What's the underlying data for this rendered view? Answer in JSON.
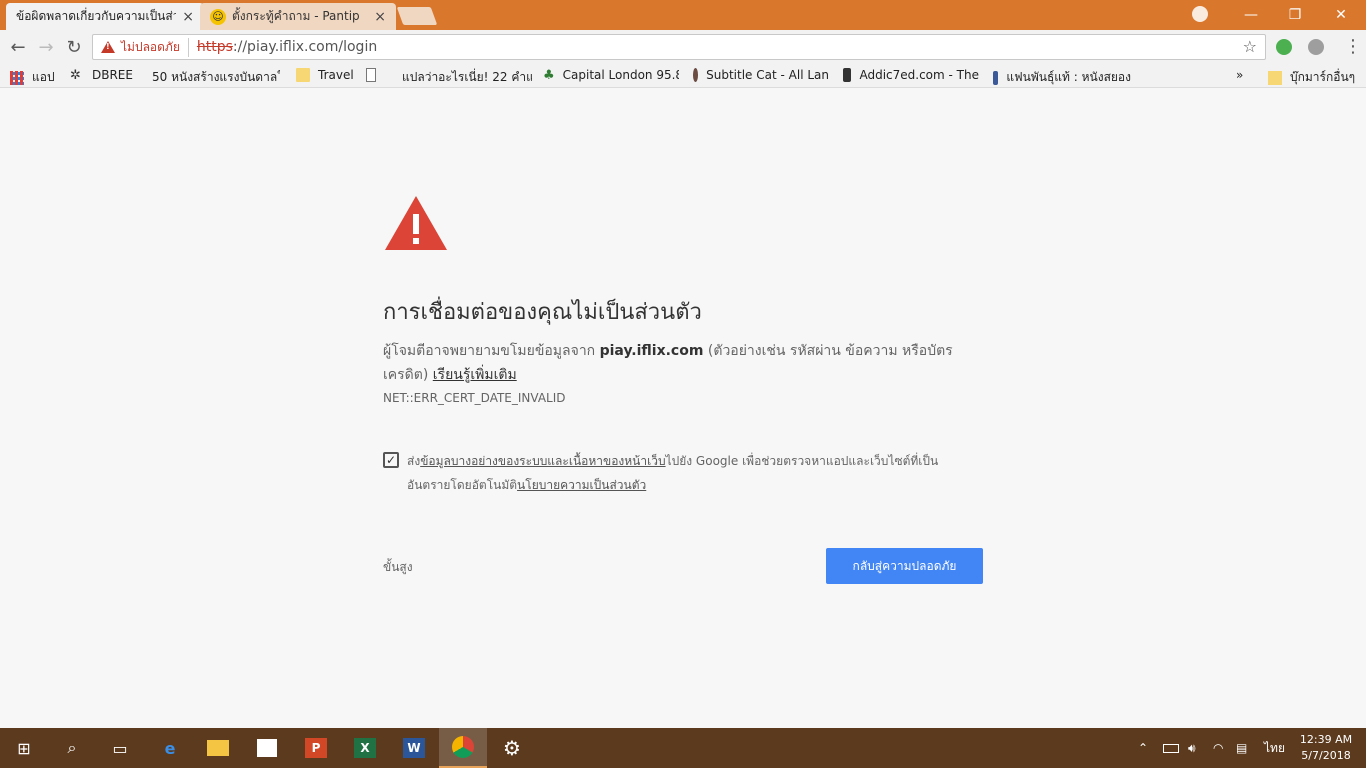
{
  "tabs": [
    {
      "label": "ข้อผิดพลาดเกี่ยวกับความเป็นส่วนตัว",
      "active": true,
      "close": "×"
    },
    {
      "label": "ตั้งกระทู้คำถาม - Pantip",
      "active": false,
      "close": "×"
    }
  ],
  "window_controls": {
    "minimize": "—",
    "restore": "❐",
    "close": "✕"
  },
  "toolbar": {
    "security_label": "ไม่ปลอดภัย",
    "url_scheme": "https",
    "url_rest": "://piay.iflix.com/login",
    "star": "☆"
  },
  "bookmarks": [
    {
      "label": "แอป",
      "icon": "apps-icon"
    },
    {
      "label": "DBREE",
      "icon": "dbree-icon"
    },
    {
      "label": "50 หนังสร้างแรงบันดาลใ",
      "icon": "smiley-icon"
    },
    {
      "label": "Travel",
      "icon": "folder-icon"
    },
    {
      "label": "",
      "icon": "page-icon"
    },
    {
      "label": "แปลว่าอะไรเนี่ย! 22 คำแ",
      "icon": "d-logo-icon"
    },
    {
      "label": "Capital London 95.8",
      "icon": "capital-icon"
    },
    {
      "label": "Subtitle Cat - All Lan",
      "icon": "subtitle-cat-icon"
    },
    {
      "label": "Addic7ed.com - The",
      "icon": "addic7ed-icon"
    },
    {
      "label": "แฟนพันธุ์แท้ : หนังสยอง",
      "icon": "facebook-icon"
    }
  ],
  "bookmarks_more": "»",
  "other_bookmarks": "บุ๊กมาร์กอื่นๆ",
  "error": {
    "heading": "การเชื่อมต่อของคุณไม่เป็นส่วนตัว",
    "desc_prefix": "ผู้โจมตีอาจพยายามขโมยข้อมูลจาก ",
    "domain": "piay.iflix.com",
    "desc_suffix": " (ตัวอย่างเช่น รหัสผ่าน ข้อความ หรือบัตรเครดิต) ",
    "learn_more": "เรียนรู้เพิ่มเติม",
    "code": "NET::ERR_CERT_DATE_INVALID",
    "checkbox_prefix": "ส่ง",
    "checkbox_link1": "ข้อมูลบางอย่างของระบบและเนื้อหาของหน้าเว็บ",
    "checkbox_middle": "ไปยัง Google เพื่อช่วยตรวจหาแอปและเว็บไซต์ที่เป็นอันตรายโดยอัตโนมัติ",
    "checkbox_link2": "นโยบายความเป็นส่วนตัว",
    "checkbox_checked": true,
    "advanced": "ขั้นสูง",
    "back_button": "กลับสู่ความปลอดภัย"
  },
  "taskbar": {
    "items": [
      "start",
      "search",
      "task-view",
      "edge",
      "file-explorer",
      "store",
      "powerpoint",
      "excel",
      "word",
      "chrome",
      "settings"
    ],
    "language": "ไทย",
    "time": "12:39 AM",
    "date": "5/7/2018"
  },
  "colors": {
    "titlebar": "#d9782d",
    "danger": "#c53929",
    "primary": "#4285f4"
  }
}
